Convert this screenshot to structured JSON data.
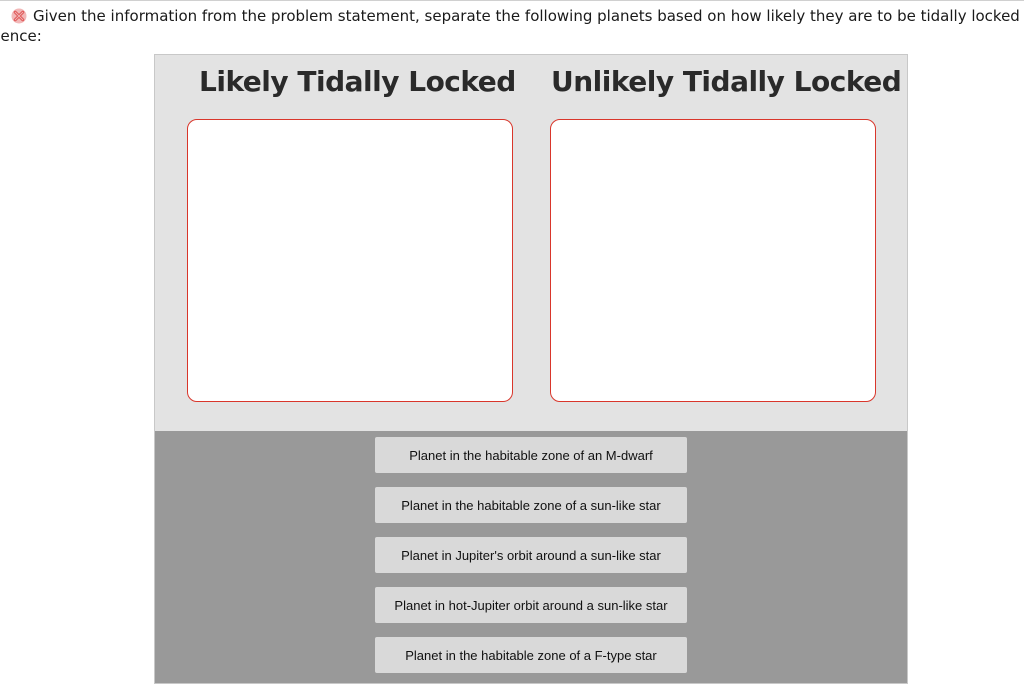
{
  "question": {
    "line1": "Given the information from the problem statement, separate the following planets based on how likely they are to be tidally locked if we find the plan",
    "line2": "uence:",
    "status_icon": "incorrect-x-icon"
  },
  "bins": [
    {
      "title": "Likely Tidally Locked"
    },
    {
      "title": "Unlikely Tidally Locked"
    }
  ],
  "cards": [
    {
      "label": "Planet in the habitable zone of an M-dwarf"
    },
    {
      "label": "Planet in the habitable zone of a sun-like star"
    },
    {
      "label": "Planet in Jupiter's orbit around a sun-like star"
    },
    {
      "label": "Planet in hot-Jupiter orbit around a sun-like star"
    },
    {
      "label": "Planet in the habitable zone of a F-type star"
    }
  ],
  "colors": {
    "bin_border": "#d9362b",
    "drop_area_bg": "#e3e3e3",
    "card_area_bg": "#999999",
    "card_bg": "#d9d9d9",
    "incorrect_icon": "#e05a5a"
  }
}
